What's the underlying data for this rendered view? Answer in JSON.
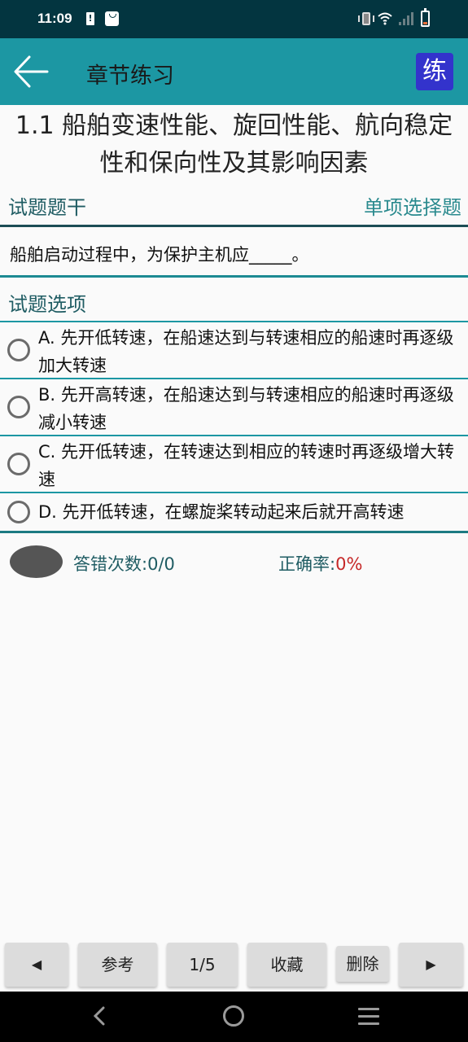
{
  "status_bar": {
    "time": "11:09",
    "left_icons": [
      "battery-alert-icon",
      "shopping-bag-icon"
    ],
    "right_icons": [
      "vibrate-icon",
      "wifi-icon",
      "signal-icon",
      "battery-low-icon"
    ]
  },
  "app_bar": {
    "title": "章节练习",
    "back_icon": "arrow-left-icon",
    "mode_badge": "练"
  },
  "chapter": {
    "title": "1.1 船舶变速性能、旋回性能、航向稳定性和保向性及其影响因素"
  },
  "question": {
    "stem_label": "试题题干",
    "type_label": "单项选择题",
    "text": "船舶启动过程中，为保护主机应_____。",
    "options_label": "试题选项",
    "options": [
      {
        "text": "A. 先开低转速，在船速达到与转速相应的船速时再逐级加大转速",
        "selected": false
      },
      {
        "text": "B. 先开高转速，在船速达到与转速相应的船速时再逐级减小转速",
        "selected": false
      },
      {
        "text": "C. 先开低转速，在转速达到相应的转速时再逐级增大转速",
        "selected": false
      },
      {
        "text": "D. 先开低转速，在螺旋桨转动起来后就开高转速",
        "selected": false
      }
    ]
  },
  "stats": {
    "wrong_label": "答错次数:",
    "wrong_value": "0/0",
    "accuracy_label": "正确率:",
    "accuracy_value": "0%",
    "accuracy_color": "#c62828"
  },
  "toolbar": {
    "prev_label": "◀",
    "reference_label": "参考",
    "page_label": "1/5",
    "favorite_label": "收藏",
    "delete_label": "删除",
    "next_label": "▶"
  },
  "colors": {
    "status_bar": "#033540",
    "app_bar": "#1c97a3",
    "badge": "#3333cc"
  }
}
